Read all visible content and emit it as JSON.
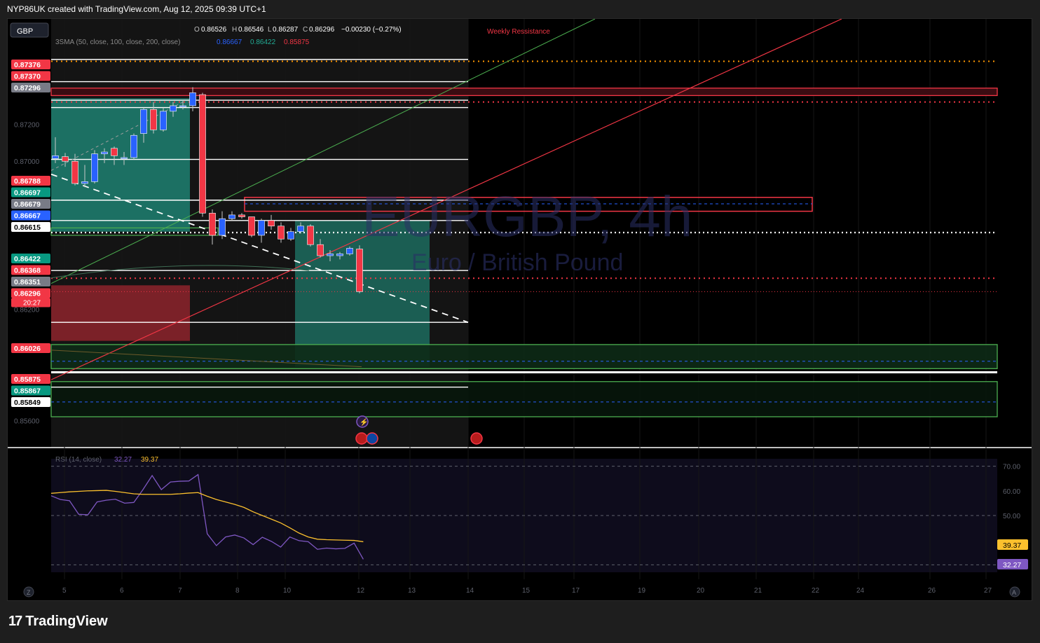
{
  "header": {
    "attribution": "NYP86UK created with TradingView.com, Aug 12, 2025 09:39 UTC+1"
  },
  "currency_button": "GBP",
  "footer": {
    "brand": "TradingView",
    "icon": "tradingview-logo-icon"
  },
  "colors": {
    "bull": "#2962ff",
    "bear": "#f23645",
    "zone_green": "#26a69a",
    "zone_red": "#b22833",
    "rsi": "#7e57c2",
    "rsi_ma": "#fbc02d"
  },
  "chart_data": [
    {
      "type": "candlestick",
      "symbol_watermark": "EURGBP, 4h",
      "symbol_description": "Euro / British Pound",
      "ohlc_legend": {
        "open": "0.86526",
        "high": "0.86546",
        "low": "0.86287",
        "close": "0.86296",
        "change": "−0.00230 (−0.27%)"
      },
      "sma_legend": {
        "label": "3SMA (50, close, 100, close, 200, close)",
        "values": [
          "0.86667",
          "0.86422",
          "0.85875"
        ]
      },
      "ylim": [
        0.8548,
        0.8775
      ],
      "x_ticks": [
        "5",
        "6",
        "7",
        "8",
        "10",
        "12",
        "13",
        "14",
        "15",
        "17",
        "19",
        "20",
        "21",
        "22",
        "24",
        "26",
        "27"
      ],
      "y_ticks": [
        "0.87200",
        "0.87000",
        "0.86200",
        "0.85600"
      ],
      "annotation": "Weekly Ressistance",
      "candles": [
        {
          "o": 0.87015,
          "h": 0.8713,
          "l": 0.8699,
          "c": 0.8703
        },
        {
          "o": 0.87025,
          "h": 0.87045,
          "l": 0.8697,
          "c": 0.87
        },
        {
          "o": 0.87,
          "h": 0.8704,
          "l": 0.8687,
          "c": 0.8688
        },
        {
          "o": 0.8688,
          "h": 0.8698,
          "l": 0.8686,
          "c": 0.8689
        },
        {
          "o": 0.8689,
          "h": 0.8706,
          "l": 0.8688,
          "c": 0.8704
        },
        {
          "o": 0.8704,
          "h": 0.8707,
          "l": 0.8699,
          "c": 0.8705
        },
        {
          "o": 0.8707,
          "h": 0.8708,
          "l": 0.8698,
          "c": 0.8703
        },
        {
          "o": 0.8702,
          "h": 0.8705,
          "l": 0.8698,
          "c": 0.8702
        },
        {
          "o": 0.8702,
          "h": 0.8715,
          "l": 0.8701,
          "c": 0.8714
        },
        {
          "o": 0.8715,
          "h": 0.8729,
          "l": 0.871,
          "c": 0.8728
        },
        {
          "o": 0.8728,
          "h": 0.8732,
          "l": 0.8715,
          "c": 0.8717
        },
        {
          "o": 0.8717,
          "h": 0.8729,
          "l": 0.8716,
          "c": 0.8727
        },
        {
          "o": 0.8727,
          "h": 0.8732,
          "l": 0.8724,
          "c": 0.873
        },
        {
          "o": 0.873,
          "h": 0.8733,
          "l": 0.8728,
          "c": 0.873
        },
        {
          "o": 0.873,
          "h": 0.874,
          "l": 0.8727,
          "c": 0.8737
        },
        {
          "o": 0.8736,
          "h": 0.8737,
          "l": 0.867,
          "c": 0.8672
        },
        {
          "o": 0.8672,
          "h": 0.8674,
          "l": 0.8655,
          "c": 0.866
        },
        {
          "o": 0.866,
          "h": 0.8673,
          "l": 0.8658,
          "c": 0.8669
        },
        {
          "o": 0.8669,
          "h": 0.8673,
          "l": 0.8668,
          "c": 0.8671
        },
        {
          "o": 0.8671,
          "h": 0.8672,
          "l": 0.8669,
          "c": 0.867
        },
        {
          "o": 0.867,
          "h": 0.867,
          "l": 0.8659,
          "c": 0.866
        },
        {
          "o": 0.866,
          "h": 0.8669,
          "l": 0.8656,
          "c": 0.8668
        },
        {
          "o": 0.8668,
          "h": 0.8671,
          "l": 0.8663,
          "c": 0.8665
        },
        {
          "o": 0.8665,
          "h": 0.8667,
          "l": 0.8656,
          "c": 0.8658
        },
        {
          "o": 0.8658,
          "h": 0.8664,
          "l": 0.8657,
          "c": 0.8662
        },
        {
          "o": 0.8662,
          "h": 0.8667,
          "l": 0.8661,
          "c": 0.8665
        },
        {
          "o": 0.8665,
          "h": 0.8666,
          "l": 0.8654,
          "c": 0.8655
        },
        {
          "o": 0.8655,
          "h": 0.8658,
          "l": 0.8648,
          "c": 0.8649
        },
        {
          "o": 0.8649,
          "h": 0.8652,
          "l": 0.8646,
          "c": 0.865
        },
        {
          "o": 0.8649,
          "h": 0.8651,
          "l": 0.8647,
          "c": 0.865
        },
        {
          "o": 0.865,
          "h": 0.8654,
          "l": 0.8649,
          "c": 0.8653
        },
        {
          "o": 0.86526,
          "h": 0.86546,
          "l": 0.86287,
          "c": 0.86296
        }
      ],
      "price_labels": [
        {
          "text": "0.87376",
          "color": "#f23645"
        },
        {
          "text": "0.87370",
          "color": "#f23645"
        },
        {
          "text": "0.87296",
          "color": "#787b86"
        },
        {
          "text": "0.86788",
          "color": "#f23645"
        },
        {
          "text": "0.86697",
          "color": "#089981"
        },
        {
          "text": "0.86679",
          "color": "#787b86"
        },
        {
          "text": "0.86667",
          "color": "#2962ff"
        },
        {
          "text": "0.86615",
          "color": "#ffffff"
        },
        {
          "text": "0.86422",
          "color": "#089981"
        },
        {
          "text": "0.86368",
          "color": "#f23645"
        },
        {
          "text": "0.86351",
          "color": "#787b86"
        },
        {
          "text": "0.86296",
          "color": "#f23645",
          "sub": "20:27"
        },
        {
          "text": "0.86026",
          "color": "#f23645"
        },
        {
          "text": "0.85875",
          "color": "#f23645"
        },
        {
          "text": "0.85867",
          "color": "#089981"
        },
        {
          "text": "0.85849",
          "color": "#ffffff"
        }
      ]
    },
    {
      "type": "line",
      "legend": {
        "label": "RSI (14, close)",
        "values": [
          "32.27",
          "39.37"
        ]
      },
      "ylim": [
        27,
        73
      ],
      "y_ticks": [
        "70.00",
        "60.00",
        "50.00"
      ],
      "series": [
        {
          "name": "RSI",
          "color": "#7e57c2",
          "values": [
            58,
            56.5,
            56,
            50.5,
            50.3,
            55.5,
            56.2,
            56.6,
            55,
            55.3,
            60.5,
            66.2,
            60.5,
            63.6,
            63.9,
            64,
            66.6,
            42.6,
            37.8,
            41.3,
            42.1,
            40.9,
            38.2,
            41.2,
            39.5,
            37.2,
            41.3,
            39.8,
            39.4,
            36.3,
            36.8,
            36.5,
            36.7,
            38.8,
            32.27
          ]
        },
        {
          "name": "RSI MA",
          "color": "#fbc02d",
          "values": [
            59,
            59.3,
            59.6,
            59.8,
            60,
            60.1,
            60.2,
            59.8,
            59.3,
            58.8,
            58.6,
            58.6,
            58.6,
            58.6,
            58.8,
            59.1,
            59.3,
            57.8,
            56.5,
            55.5,
            54.5,
            53.3,
            51.5,
            50,
            48.5,
            47,
            45,
            42.9,
            41.3,
            40.4,
            40.2,
            40.1,
            40,
            39.9,
            39.37
          ]
        }
      ]
    }
  ]
}
